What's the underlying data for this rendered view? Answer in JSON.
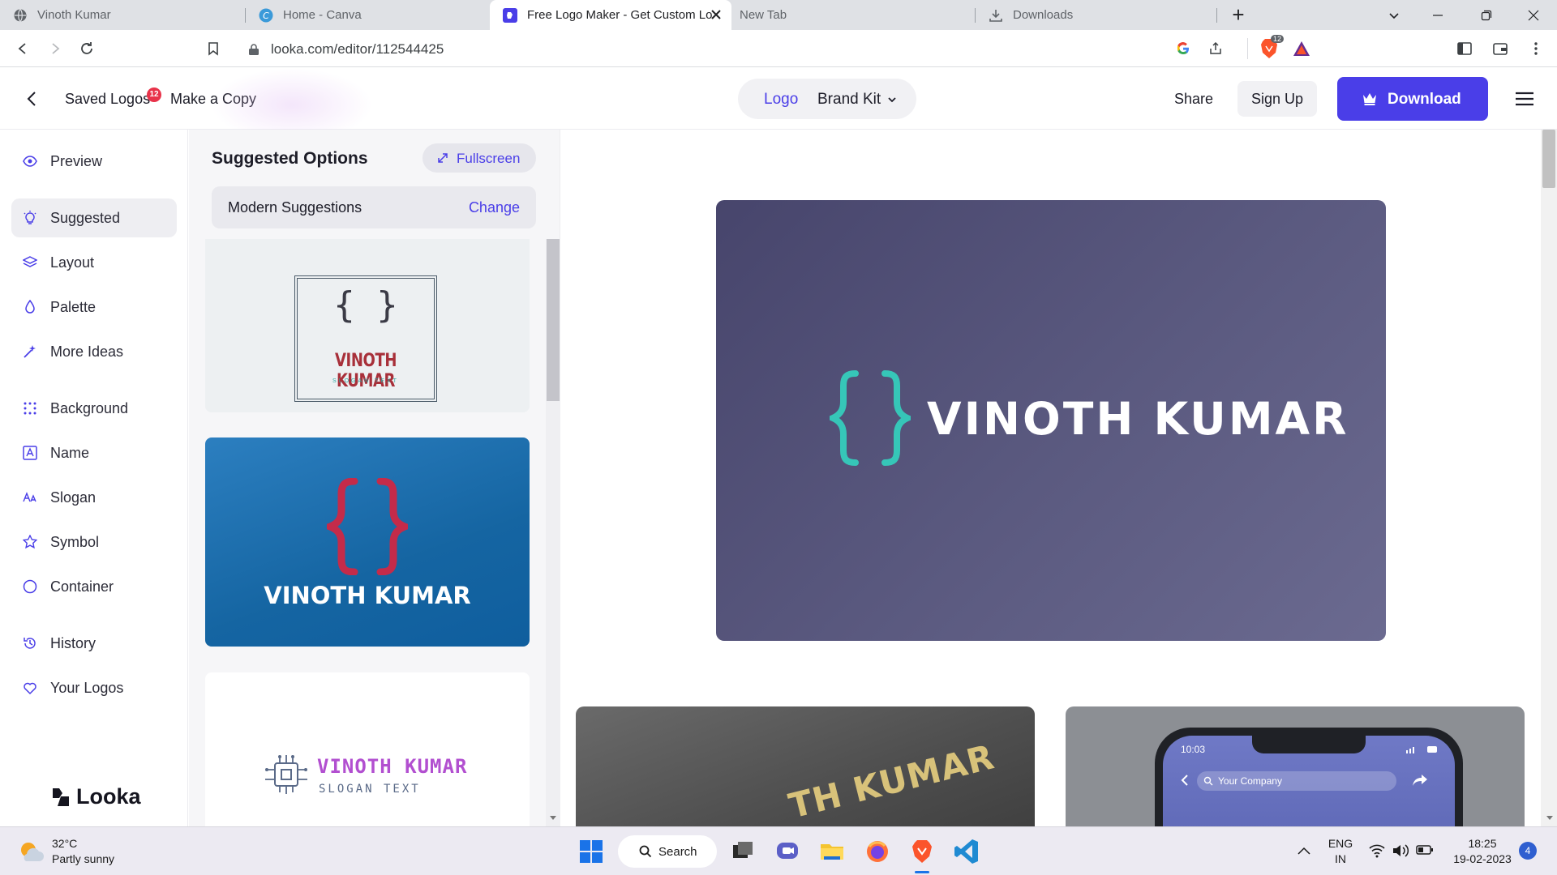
{
  "browser": {
    "tabs": [
      {
        "title": "Vinoth Kumar",
        "icon": "globe-icon",
        "active": false
      },
      {
        "title": "Home - Canva",
        "icon": "canva-icon",
        "active": false
      },
      {
        "title": "Free Logo Maker - Get Custom Lo",
        "icon": "looka-icon",
        "active": true
      },
      {
        "title": "New Tab",
        "icon": "",
        "active": false
      },
      {
        "title": "Downloads",
        "icon": "download-icon",
        "active": false
      }
    ],
    "new_tab": "+",
    "url": "looka.com/editor/112544425",
    "brave_badge": "12"
  },
  "header": {
    "saved_logos": "Saved Logos",
    "saved_badge": "12",
    "make_copy": "Make a Copy",
    "mode_logo": "Logo",
    "mode_brand_kit": "Brand Kit",
    "share": "Share",
    "sign_up": "Sign Up",
    "download": "Download",
    "colors": {
      "accent": "#4a3ee8",
      "badge": "#e8334a"
    }
  },
  "sidebar": {
    "items": [
      {
        "label": "Preview",
        "icon": "eye-icon"
      },
      {
        "label": "Suggested",
        "icon": "lightbulb-icon",
        "active": true
      },
      {
        "label": "Layout",
        "icon": "layers-icon"
      },
      {
        "label": "Palette",
        "icon": "droplet-icon"
      },
      {
        "label": "More Ideas",
        "icon": "magic-wand-icon"
      },
      {
        "label": "Background",
        "icon": "grid-dots-icon"
      },
      {
        "label": "Name",
        "icon": "name-box-icon"
      },
      {
        "label": "Slogan",
        "icon": "text-size-icon"
      },
      {
        "label": "Symbol",
        "icon": "star-icon"
      },
      {
        "label": "Container",
        "icon": "circle-icon"
      },
      {
        "label": "History",
        "icon": "history-icon"
      },
      {
        "label": "Your Logos",
        "icon": "heart-icon"
      }
    ],
    "brand": "Looka"
  },
  "suggestions": {
    "title": "Suggested Options",
    "fullscreen": "Fullscreen",
    "category": "Modern Suggestions",
    "change": "Change",
    "cards": [
      {
        "name": "VINOTH KUMAR",
        "slogan": "SLOGAN TEXT",
        "symbol": "{ }",
        "bg": "#edf0f2",
        "name_color": "#a8303a",
        "slogan_color": "#2aa6a0"
      },
      {
        "name": "VINOTH KUMAR",
        "symbol": "{ }",
        "bg": "#1a6aa6",
        "name_color": "#ffffff",
        "symbol_color": "#c42b4a"
      },
      {
        "name": "VINOTH KUMAR",
        "slogan": "SLOGAN TEXT",
        "name_color": "#b24fd0",
        "slogan_color": "#5a6a88"
      }
    ]
  },
  "canvas": {
    "logo_name": "VINOTH KUMAR",
    "logo_symbol_color": "#36c6b8",
    "mockup_card_text": "TH KUMAR",
    "phone_time": "10:03",
    "phone_search": "Your Company"
  },
  "taskbar": {
    "temperature": "32°C",
    "weather": "Partly sunny",
    "search": "Search",
    "lang_1": "ENG",
    "lang_2": "IN",
    "time": "18:25",
    "date": "19-02-2023",
    "notifications": "4"
  }
}
